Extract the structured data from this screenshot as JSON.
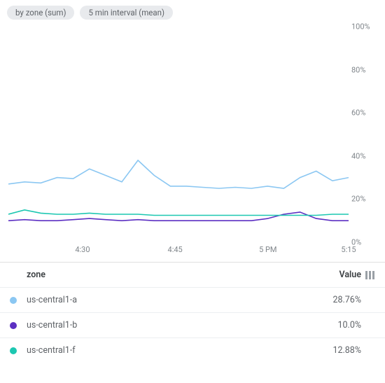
{
  "pills": [
    "by zone (sum)",
    "5 min interval (mean)"
  ],
  "legend_header": {
    "name_col": "zone",
    "value_col": "Value"
  },
  "legend_rows": [
    {
      "color": "#8bc7f2",
      "name": "us-central1-a",
      "value": "28.76%"
    },
    {
      "color": "#5c2fc2",
      "name": "us-central1-b",
      "value": "10.0%"
    },
    {
      "color": "#1cc7b1",
      "name": "us-central1-f",
      "value": "12.88%"
    }
  ],
  "chart_data": {
    "type": "line",
    "xlabel": "",
    "ylabel": "",
    "ylim": [
      0,
      100
    ],
    "y_unit": "%",
    "x_ticks": [
      {
        "label": "4:30",
        "pos": 0.218
      },
      {
        "label": "4:45",
        "pos": 0.49
      },
      {
        "label": "5 PM",
        "pos": 0.763
      },
      {
        "label": "5:15",
        "pos": 1.0
      }
    ],
    "y_ticks": [
      0,
      20,
      40,
      60,
      80,
      100
    ],
    "series": [
      {
        "name": "us-central1-a",
        "color": "#8bc7f2",
        "values": [
          27,
          28,
          27.5,
          30,
          29.5,
          34,
          31,
          28,
          38,
          31,
          26,
          26,
          25.5,
          25,
          25.5,
          25,
          26,
          25,
          30,
          33,
          28.5,
          30
        ]
      },
      {
        "name": "us-central1-b",
        "color": "#5c2fc2",
        "values": [
          10,
          10.5,
          10,
          10,
          10.5,
          11,
          10.5,
          10,
          10.5,
          10,
          10,
          10,
          10,
          10,
          10,
          10,
          11,
          13,
          14,
          11,
          10,
          10
        ]
      },
      {
        "name": "us-central1-f",
        "color": "#1cc7b1",
        "values": [
          13,
          15,
          13.5,
          13,
          13,
          13.5,
          13,
          13,
          13,
          12.5,
          12.5,
          12.5,
          12.5,
          12.5,
          12.5,
          12.5,
          12.5,
          12.5,
          12.5,
          12.5,
          13,
          13
        ]
      }
    ]
  }
}
